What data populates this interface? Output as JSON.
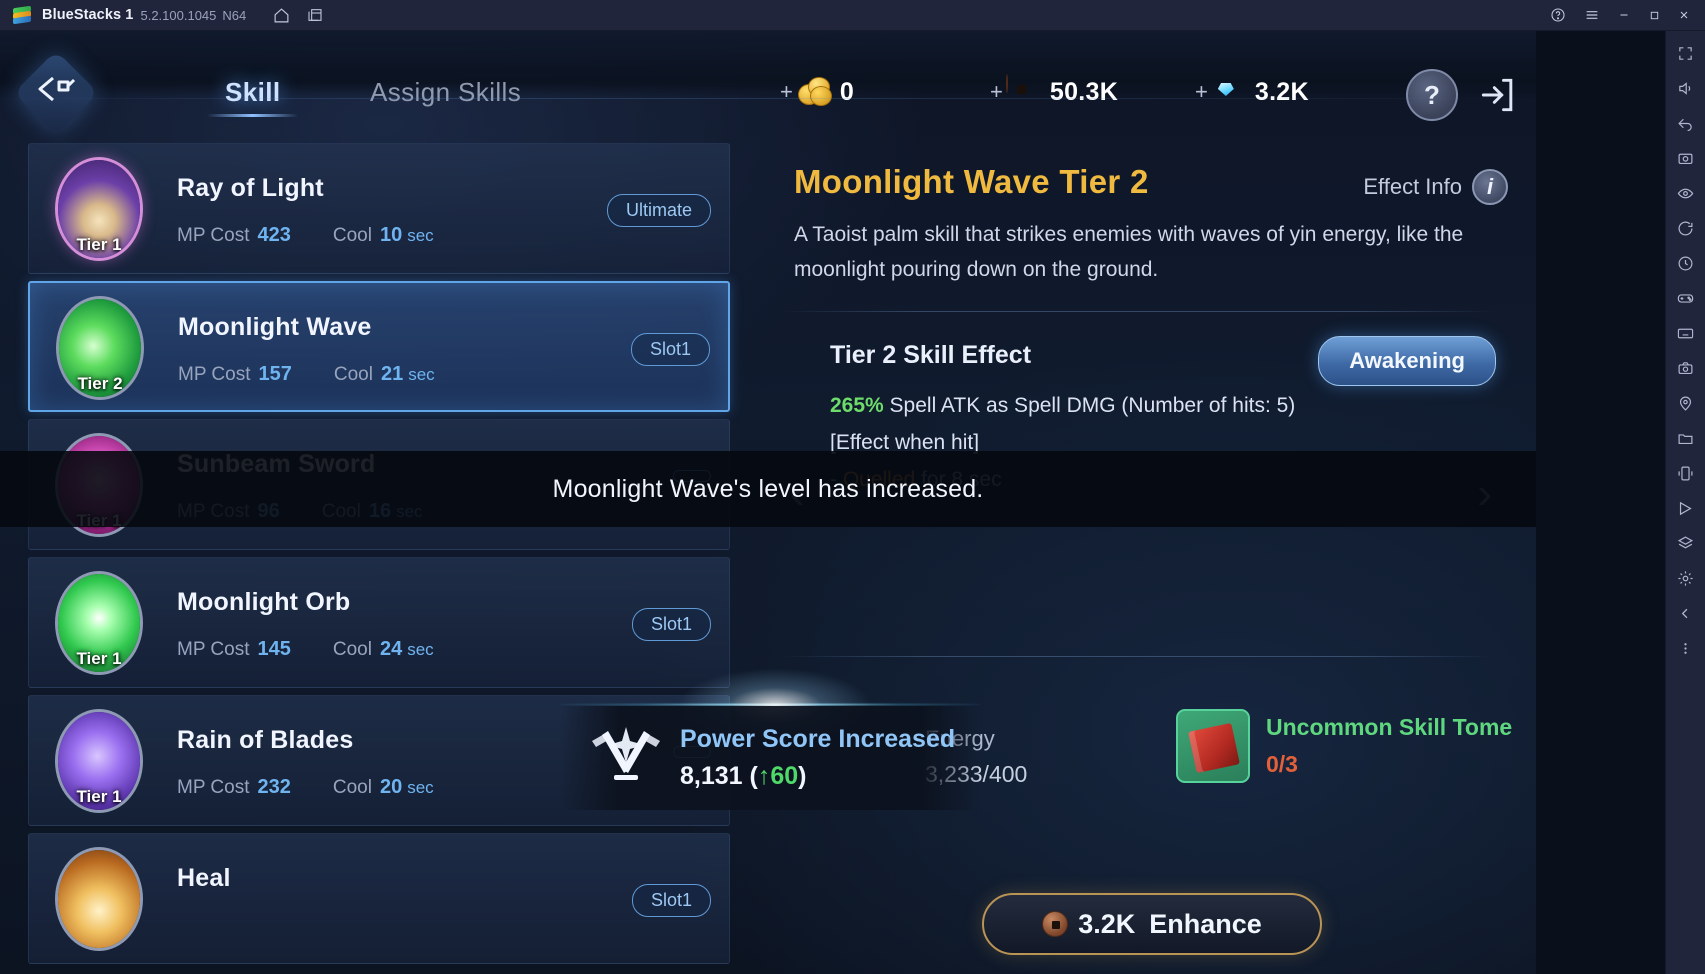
{
  "bluestacks": {
    "app_name": "BlueStacks 1",
    "version": "5.2.100.1045",
    "instance": "N64",
    "icons": {
      "logo": "bluestacks-logo",
      "home": "home-icon",
      "multi_instance": "multi-instance-icon",
      "help": "help-circle-icon",
      "menu": "hamburger-menu-icon",
      "minimize": "minimize-icon",
      "maximize": "maximize-icon",
      "close": "close-icon"
    },
    "sidebar": [
      "fullscreen-icon",
      "volume-icon",
      "back-icon",
      "screenshot-icon",
      "eye-icon",
      "rotate-icon",
      "clock-icon",
      "gamepad-icon",
      "keyboard-icon",
      "camera-icon",
      "location-icon",
      "folder-icon",
      "shake-icon",
      "macro-icon",
      "layers-icon",
      "gear-icon",
      "arrow-left-icon",
      "more-icon"
    ]
  },
  "header": {
    "home_glyph": "⌨",
    "tabs": [
      {
        "label": "Skill",
        "active": true
      },
      {
        "label": "Assign Skills",
        "active": false
      }
    ],
    "currencies": [
      {
        "name": "gold",
        "plus": "+",
        "value": "0"
      },
      {
        "name": "copper-coin",
        "plus": "+",
        "value": "50.3K"
      },
      {
        "name": "gem",
        "plus": "+",
        "value": "3.2K"
      }
    ],
    "help_label": "?",
    "exit_label": "exit-icon"
  },
  "skill_list": [
    {
      "name": "Ray of Light",
      "tier": "Tier 1",
      "mp_label": "MP Cost",
      "mp_value": "423",
      "cool_label": "Cool",
      "cool_value": "10",
      "cool_unit": "sec",
      "pill": "Ultimate",
      "art": "ray",
      "rim": "purple-rim",
      "selected": false
    },
    {
      "name": "Moonlight Wave",
      "tier": "Tier 2",
      "mp_label": "MP Cost",
      "mp_value": "157",
      "cool_label": "Cool",
      "cool_value": "21",
      "cool_unit": "sec",
      "pill": "Slot1",
      "art": "moonw",
      "rim": "",
      "selected": true
    },
    {
      "name": "Sunbeam Sword",
      "tier": "Tier 1",
      "mp_label": "MP Cost",
      "mp_value": "96",
      "cool_label": "Cool",
      "cool_value": "16",
      "cool_unit": "sec",
      "pill": "",
      "art": "sunbeam",
      "rim": "",
      "selected": false
    },
    {
      "name": "Moonlight Orb",
      "tier": "Tier 1",
      "mp_label": "MP Cost",
      "mp_value": "145",
      "cool_label": "Cool",
      "cool_value": "24",
      "cool_unit": "sec",
      "pill": "Slot1",
      "art": "moonorb",
      "rim": "",
      "selected": false
    },
    {
      "name": "Rain of Blades",
      "tier": "Tier 1",
      "mp_label": "MP Cost",
      "mp_value": "232",
      "cool_label": "Cool",
      "cool_value": "20",
      "cool_unit": "sec",
      "pill": "",
      "art": "rain",
      "rim": "",
      "selected": false
    },
    {
      "name": "Heal",
      "tier": "",
      "mp_label": "",
      "mp_value": "",
      "cool_label": "",
      "cool_value": "",
      "cool_unit": "",
      "pill": "Slot1",
      "art": "heal",
      "rim": "",
      "selected": false
    }
  ],
  "detail": {
    "title": "Moonlight Wave Tier 2",
    "effect_info_label": "Effect Info",
    "effect_info_icon": "i",
    "description": "A Taoist palm skill that strikes enemies with waves of yin energy, like the moonlight pouring down on the ground.",
    "effect_heading": "Tier 2 Skill Effect",
    "awakening_label": "Awakening",
    "effect_pct": "265%",
    "effect_line1_rest": " Spell ATK as Spell DMG (Number of hits: 5)",
    "effect_line2": "[Effect when hit]",
    "effect_line3_prefix": "- ",
    "effect_line3_status": "Quelled",
    "effect_line3_rest": " for 8 sec",
    "arrow_left": "‹",
    "arrow_right": "›"
  },
  "bottom": {
    "energy_label": "Energy",
    "energy_value": "3,233/400",
    "tome_name": "Uncommon Skill Tome",
    "tome_count": "0/3",
    "enhance_cost": "3.2K",
    "enhance_label": "Enhance"
  },
  "toast": {
    "message": "Moonlight Wave's level has increased."
  },
  "power_banner": {
    "title": "Power Score Increased",
    "value": "8,131 (",
    "delta": "↑60",
    "value_suffix": ")"
  },
  "colors": {
    "accent_gold": "#f0b93f",
    "accent_blue": "#6fb4f0",
    "green": "#6ddc6a",
    "orange": "#e08a3c",
    "tome_green": "#5fd77f",
    "tome_count": "#e2603a"
  }
}
